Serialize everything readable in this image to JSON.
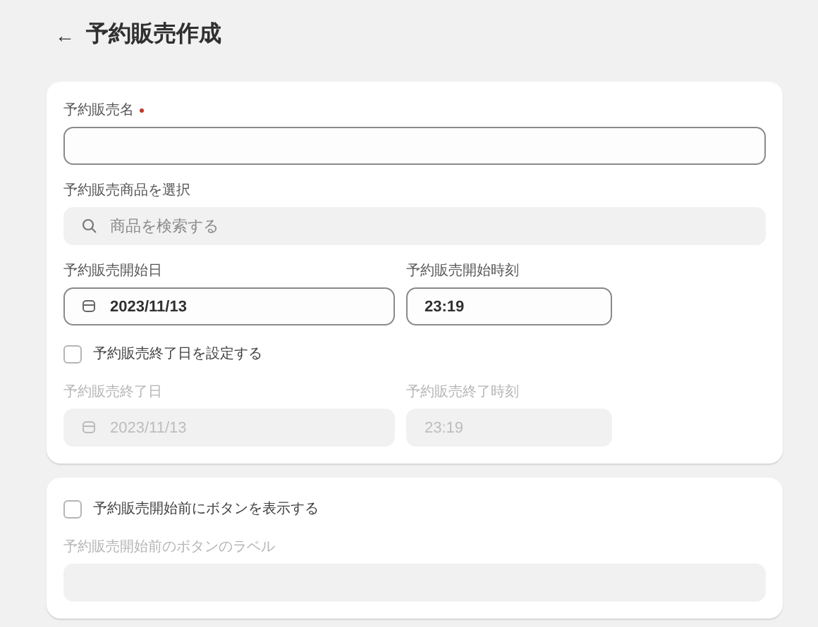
{
  "header": {
    "back_icon": "←",
    "title": "予約販売作成"
  },
  "cards": [
    {
      "items": [
        {
          "kind": "text",
          "label": "予約販売名",
          "required": true,
          "value": "",
          "disabled": false
        },
        {
          "kind": "search",
          "label": "予約販売商品を選択",
          "placeholder": "商品を検索する"
        },
        {
          "kind": "pair",
          "fields": [
            {
              "kind": "date",
              "label": "予約販売開始日",
              "value": "2023/11/13",
              "disabled": false
            },
            {
              "kind": "time",
              "label": "予約販売開始時刻",
              "value": "23:19",
              "disabled": false
            }
          ]
        },
        {
          "kind": "checkbox",
          "label": "予約販売終了日を設定する",
          "checked": false
        },
        {
          "kind": "pair",
          "fields": [
            {
              "kind": "date",
              "label": "予約販売終了日",
              "value": "2023/11/13",
              "disabled": true
            },
            {
              "kind": "time",
              "label": "予約販売終了時刻",
              "value": "23:19",
              "disabled": true
            }
          ]
        }
      ]
    },
    {
      "items": [
        {
          "kind": "checkbox",
          "label": "予約販売開始前にボタンを表示する",
          "checked": false
        },
        {
          "kind": "text",
          "label": "予約販売開始前のボタンのラベル",
          "required": false,
          "value": "",
          "disabled": true
        }
      ]
    }
  ]
}
